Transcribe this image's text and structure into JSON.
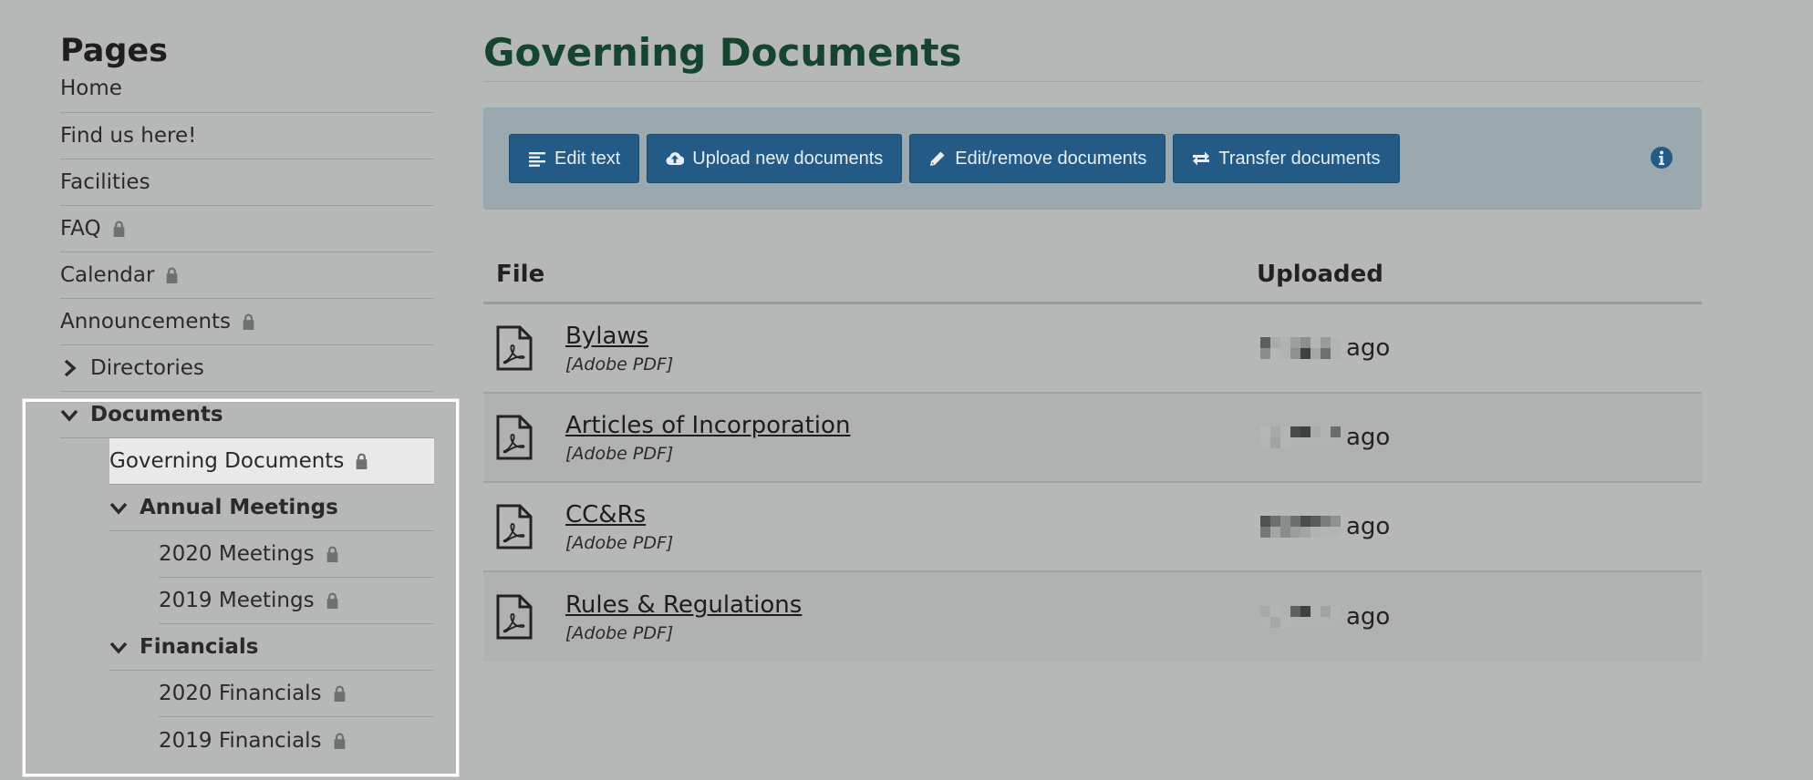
{
  "sidebar": {
    "title": "Pages",
    "items": [
      {
        "label": "Home",
        "locked": false
      },
      {
        "label": "Find us here!",
        "locked": false
      },
      {
        "label": "Facilities",
        "locked": false
      },
      {
        "label": "FAQ",
        "locked": true
      },
      {
        "label": "Calendar",
        "locked": true
      },
      {
        "label": "Announcements",
        "locked": true
      },
      {
        "label": "Directories",
        "locked": false,
        "expandable": true,
        "expanded": false
      },
      {
        "label": "Documents",
        "locked": false,
        "expandable": true,
        "expanded": true
      },
      {
        "label": "Governing Documents",
        "locked": true,
        "active": true
      },
      {
        "label": "Annual Meetings",
        "expandable": true,
        "expanded": true
      },
      {
        "label": "2020 Meetings",
        "locked": true
      },
      {
        "label": "2019 Meetings",
        "locked": true
      },
      {
        "label": "Financials",
        "expandable": true,
        "expanded": true
      },
      {
        "label": "2020 Financials",
        "locked": true
      },
      {
        "label": "2019 Financials",
        "locked": true
      }
    ]
  },
  "main": {
    "title": "Governing Documents",
    "toolbar": {
      "edit_text": "Edit text",
      "upload": "Upload new documents",
      "edit_remove": "Edit/remove documents",
      "transfer": "Transfer documents"
    },
    "table": {
      "col_file": "File",
      "col_uploaded": "Uploaded",
      "rows": [
        {
          "name": "Bylaws",
          "type": "[Adobe PDF]",
          "uploaded_suffix": "ago"
        },
        {
          "name": "Articles of Incorporation",
          "type": "[Adobe PDF]",
          "uploaded_suffix": "ago"
        },
        {
          "name": "CC&Rs",
          "type": "[Adobe PDF]",
          "uploaded_suffix": "ago"
        },
        {
          "name": "Rules & Regulations",
          "type": "[Adobe PDF]",
          "uploaded_suffix": "ago"
        }
      ]
    }
  },
  "colors": {
    "background": "#b6b8b7",
    "title_green": "#15452f",
    "button_blue": "#235b86",
    "toolbar_bg": "#9aa8b0",
    "active_item_bg": "#e9e9e9"
  },
  "icons": {
    "lock": "lock-icon",
    "chevron_right": "chevron-right-icon",
    "chevron_down": "chevron-down-icon",
    "edit_text": "align-left-icon",
    "upload": "cloud-upload-icon",
    "edit_remove": "pencil-icon",
    "transfer": "exchange-icon",
    "info": "info-icon",
    "file": "pdf-file-icon"
  }
}
